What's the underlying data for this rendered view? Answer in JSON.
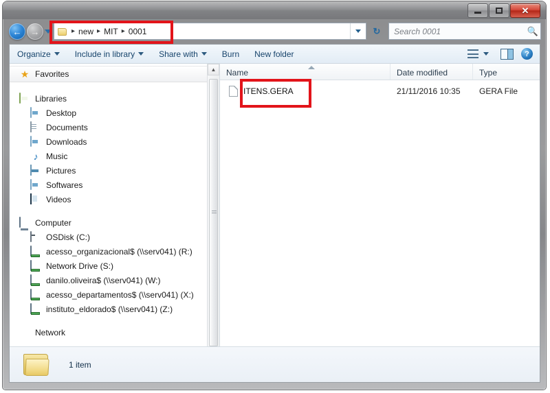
{
  "window": {
    "controls": {
      "minimize": "minimize-button",
      "maximize": "maximize-button",
      "close": "✕"
    }
  },
  "navigation": {
    "back_glyph": "←",
    "forward_glyph": "→",
    "refresh_glyph": "↻",
    "address": {
      "crumbs": [
        "new",
        "MIT",
        "0001"
      ],
      "separator": "▸"
    },
    "search": {
      "placeholder": "Search 0001",
      "icon": "search-icon"
    }
  },
  "toolbar": {
    "items": [
      {
        "label": "Organize",
        "has_menu": true
      },
      {
        "label": "Include in library",
        "has_menu": true
      },
      {
        "label": "Share with",
        "has_menu": true
      },
      {
        "label": "Burn",
        "has_menu": false
      },
      {
        "label": "New folder",
        "has_menu": false
      }
    ],
    "right": {
      "view_icon": "view-list-icon",
      "view_dropdown": "chevron-down-icon",
      "preview_pane": "preview-pane-icon",
      "help": "?"
    }
  },
  "sidebar": {
    "favorites": {
      "label": "Favorites",
      "icon": "star-icon"
    },
    "libraries": {
      "label": "Libraries",
      "icon": "library-icon",
      "items": [
        {
          "label": "Desktop",
          "icon": "desktop-library-icon"
        },
        {
          "label": "Documents",
          "icon": "documents-library-icon"
        },
        {
          "label": "Downloads",
          "icon": "downloads-library-icon"
        },
        {
          "label": "Music",
          "icon": "music-library-icon"
        },
        {
          "label": "Pictures",
          "icon": "pictures-library-icon"
        },
        {
          "label": "Softwares",
          "icon": "softwares-library-icon"
        },
        {
          "label": "Videos",
          "icon": "videos-library-icon"
        }
      ]
    },
    "computer": {
      "label": "Computer",
      "icon": "computer-icon",
      "items": [
        {
          "label": "OSDisk (C:)",
          "icon": "hard-drive-icon"
        },
        {
          "label": "acesso_organizacional$ (\\\\serv041) (R:)",
          "icon": "network-drive-icon"
        },
        {
          "label": "Network Drive (S:)",
          "icon": "network-drive-icon"
        },
        {
          "label": "danilo.oliveira$ (\\\\serv041) (W:)",
          "icon": "network-drive-icon"
        },
        {
          "label": "acesso_departamentos$ (\\\\serv041) (X:)",
          "icon": "network-drive-icon"
        },
        {
          "label": "instituto_eldorado$ (\\\\serv041) (Z:)",
          "icon": "network-drive-icon"
        }
      ]
    },
    "network": {
      "label": "Network",
      "icon": "network-icon"
    }
  },
  "filelist": {
    "columns": [
      {
        "key": "name",
        "label": "Name",
        "sorted": "asc"
      },
      {
        "key": "date",
        "label": "Date modified"
      },
      {
        "key": "type",
        "label": "Type"
      }
    ],
    "rows": [
      {
        "name": "ITENS.GERA",
        "date": "21/11/2016 10:35",
        "type": "GERA File",
        "icon": "generic-file-icon"
      }
    ]
  },
  "statusbar": {
    "item_count": "1 item",
    "folder_icon": "folder-icon"
  },
  "annotations": {
    "highlight_color": "#e2141a",
    "boxes": [
      "address-bar-highlight",
      "file-item-highlight"
    ]
  },
  "scrollbars": {
    "up_arrow": "▲",
    "down_arrow": "▼",
    "left_arrow": "◀",
    "right_arrow": "▶"
  }
}
